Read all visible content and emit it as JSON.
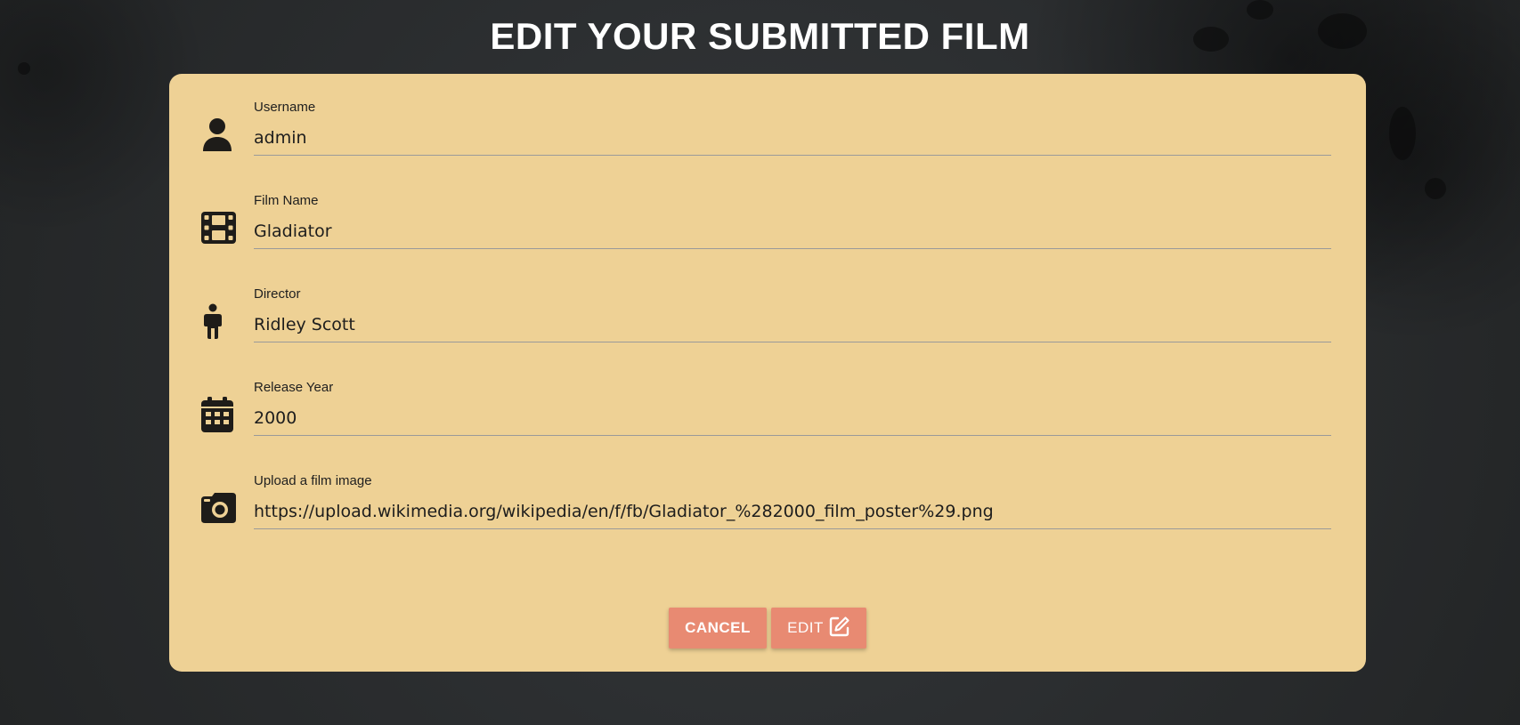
{
  "page": {
    "title": "EDIT YOUR SUBMITTED FILM"
  },
  "form": {
    "fields": [
      {
        "id": "username",
        "label": "Username",
        "value": "admin",
        "icon": "person-icon"
      },
      {
        "id": "film_name",
        "label": "Film Name",
        "value": "Gladiator",
        "icon": "film-icon"
      },
      {
        "id": "director",
        "label": "Director",
        "value": "Ridley Scott",
        "icon": "standing-person-icon"
      },
      {
        "id": "release_year",
        "label": "Release Year",
        "value": "2000",
        "icon": "calendar-icon"
      },
      {
        "id": "film_image",
        "label": "Upload a film image",
        "value": "https://upload.wikimedia.org/wikipedia/en/f/fb/Gladiator_%282000_film_poster%29.png",
        "icon": "camera-icon"
      }
    ],
    "buttons": {
      "cancel_label": "CANCEL",
      "edit_label": "EDIT",
      "edit_icon": "edit-icon"
    }
  },
  "colors": {
    "background": "#2a2c2d",
    "card": "#eed195",
    "button": "#e88a72",
    "title": "#ffffff"
  }
}
